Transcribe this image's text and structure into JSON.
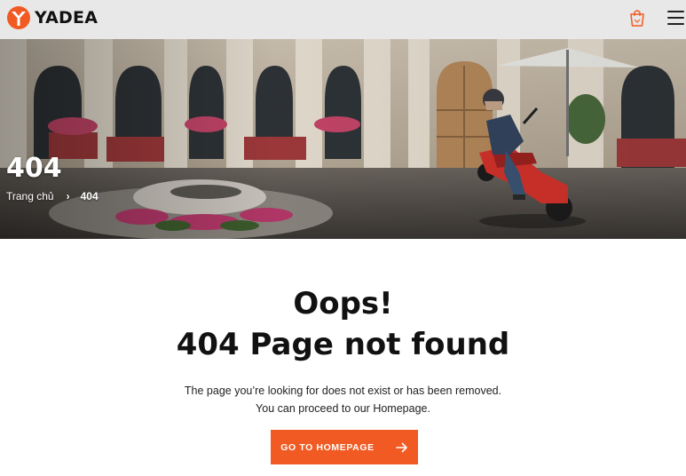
{
  "header": {
    "brand": "YADEA",
    "logo_icon": "yadea-logo-icon",
    "cart_icon": "shopping-bag-icon",
    "menu_icon": "hamburger-menu-icon",
    "accent_color": "#f15a22"
  },
  "hero": {
    "title": "404",
    "breadcrumb": {
      "home": "Trang chủ",
      "separator": "›",
      "current": "404"
    }
  },
  "content": {
    "heading_line1": "Oops!",
    "heading_line2": "404 Page not found",
    "description_line1": "The page you’re looking for does not exist or has been removed.",
    "description_line2": "You can proceed to our Homepage.",
    "button_label": "GO TO HOMEPAGE",
    "button_icon": "arrow-right-icon"
  }
}
